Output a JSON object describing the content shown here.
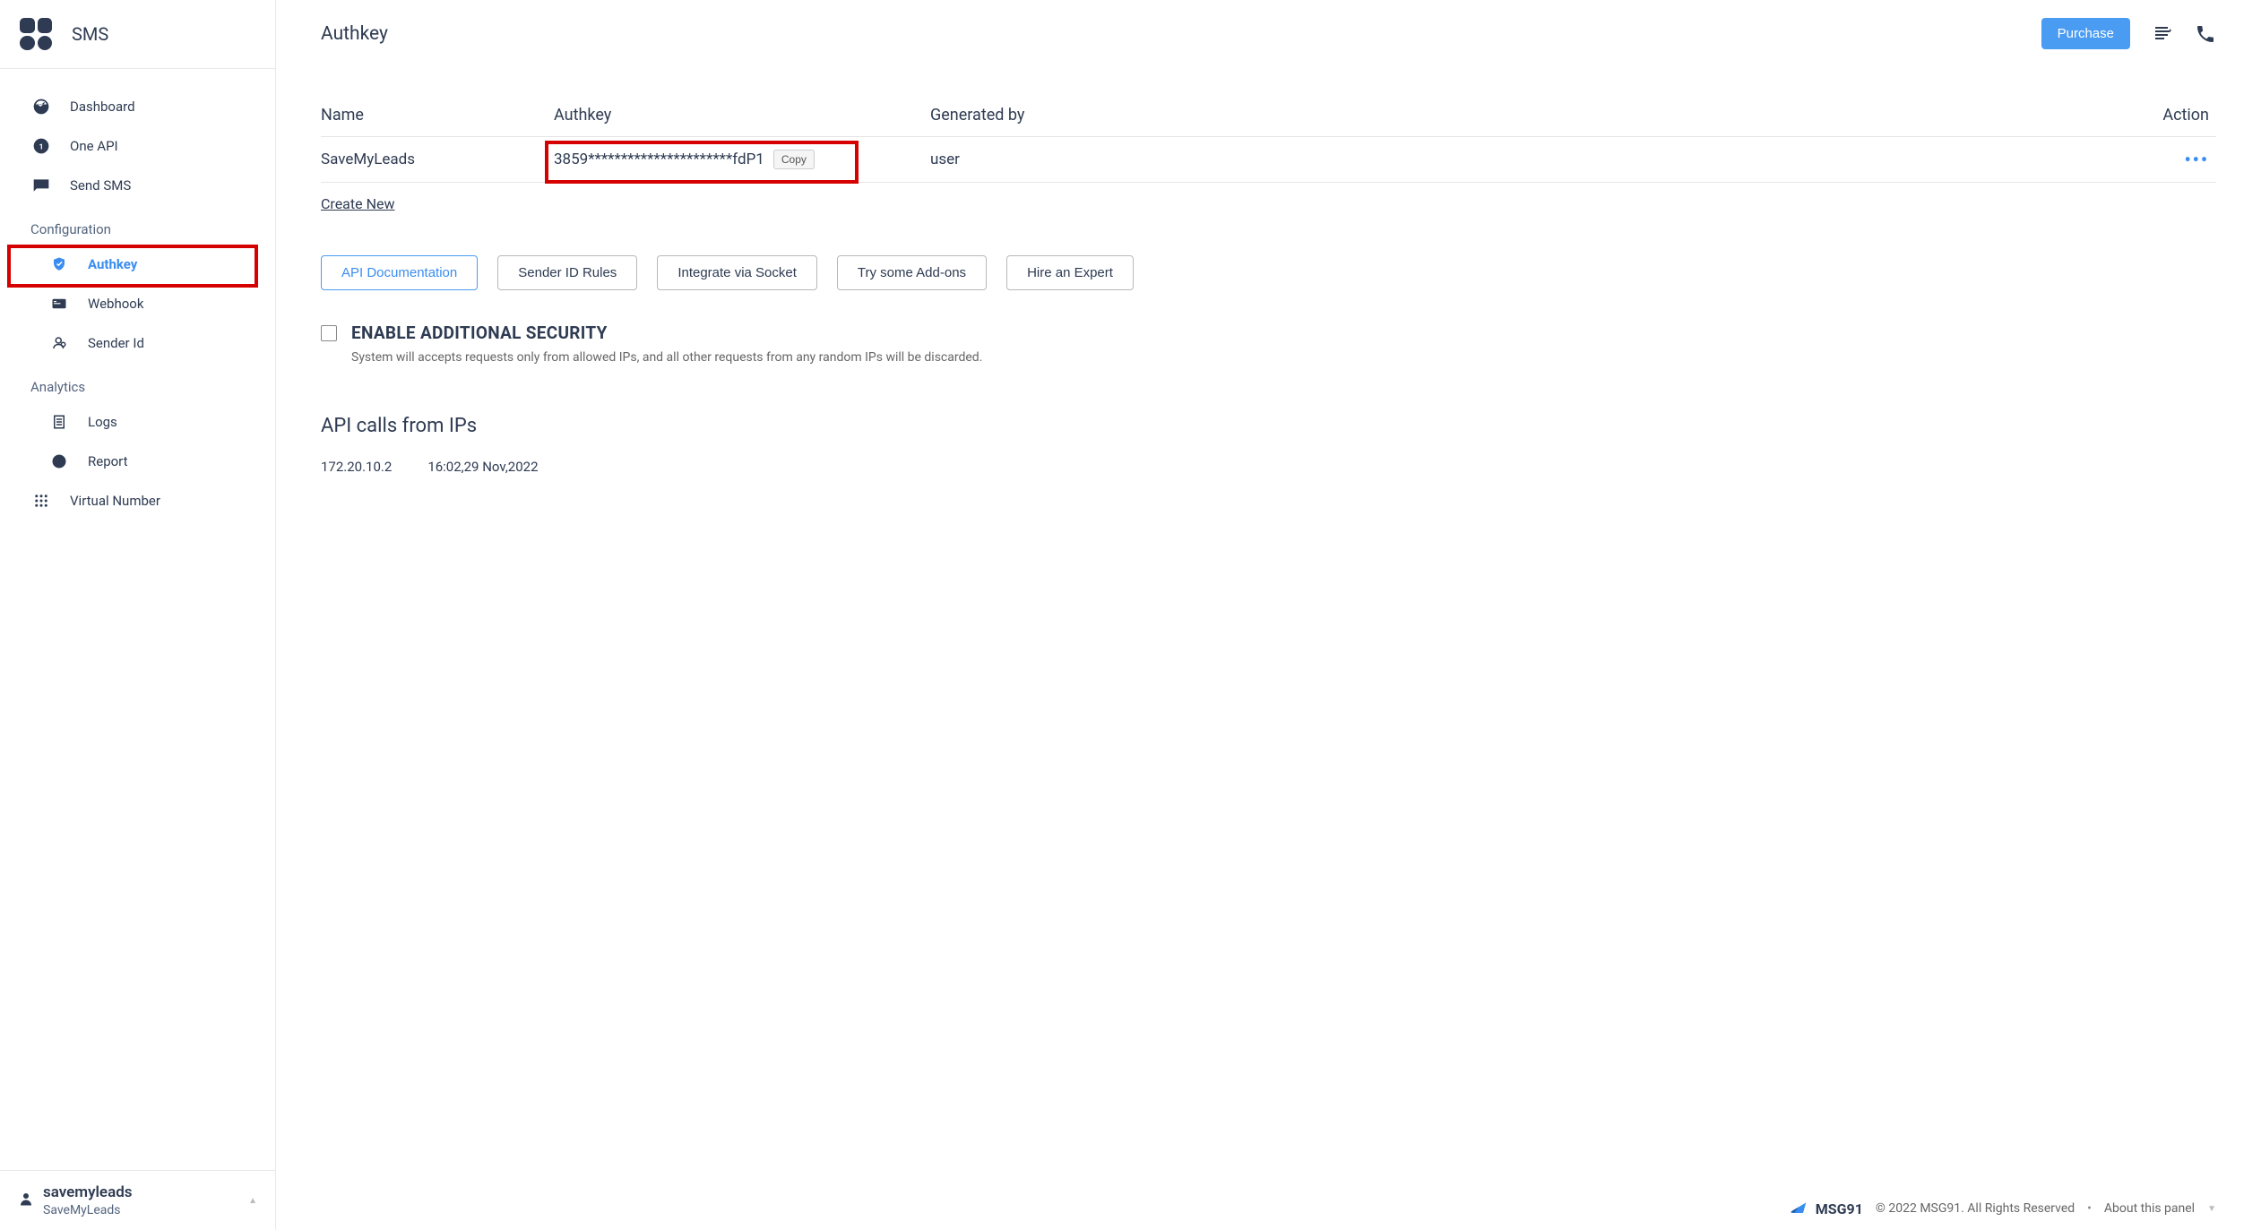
{
  "app": {
    "title": "SMS"
  },
  "sidebar": {
    "items": [
      {
        "label": "Dashboard"
      },
      {
        "label": "One API"
      },
      {
        "label": "Send SMS"
      }
    ],
    "configHeading": "Configuration",
    "configItems": [
      {
        "label": "Authkey"
      },
      {
        "label": "Webhook"
      },
      {
        "label": "Sender Id"
      }
    ],
    "analyticsHeading": "Analytics",
    "analyticsItems": [
      {
        "label": "Logs"
      },
      {
        "label": "Report"
      }
    ],
    "bottomItems": [
      {
        "label": "Virtual Number"
      }
    ],
    "user": {
      "name": "savemyleads",
      "sub": "SaveMyLeads"
    }
  },
  "header": {
    "title": "Authkey",
    "purchase": "Purchase"
  },
  "table": {
    "headers": {
      "name": "Name",
      "key": "Authkey",
      "gen": "Generated by",
      "action": "Action"
    },
    "row": {
      "name": "SaveMyLeads",
      "key": "3859**********************fdP1",
      "copy": "Copy",
      "gen": "user"
    }
  },
  "createNew": "Create New",
  "buttons": {
    "api": "API Documentation",
    "sender": "Sender ID Rules",
    "socket": "Integrate via Socket",
    "addons": "Try some Add-ons",
    "expert": "Hire an Expert"
  },
  "security": {
    "title": "ENABLE ADDITIONAL SECURITY",
    "desc": "System will accepts requests only from allowed IPs, and all other requests from any random IPs will be discarded."
  },
  "apiCalls": {
    "heading": "API calls from IPs",
    "ip": "172.20.10.2",
    "time": "16:02,29 Nov,2022"
  },
  "footer": {
    "brand": "MSG91",
    "copyright": "© 2022 MSG91. All Rights Reserved",
    "about": "About this panel"
  }
}
